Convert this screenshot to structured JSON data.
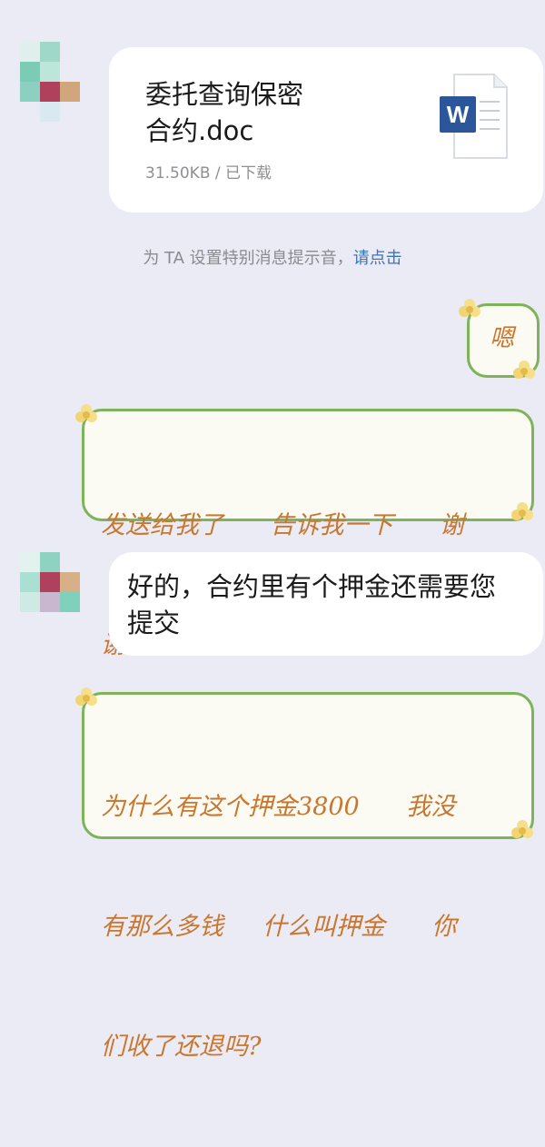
{
  "file": {
    "name_line1": "委托查询保密",
    "name_line2": "合约.doc",
    "meta": "31.50KB / 已下载",
    "icon": "word-doc-icon",
    "icon_letter": "W"
  },
  "notice": {
    "text": "为 TA 设置特别消息提示音，",
    "link": "请点击"
  },
  "messages": {
    "m1": "嗯",
    "m2_line1": "发送给我了      告诉我一下      谢",
    "m2_line2": "谢   辛苦了",
    "m3_line1": "好的，合约里有个押金还需要您",
    "m3_line2": "提交",
    "m4_line1": "为什么有这个押金3800      我没",
    "m4_line2": "有那么多钱     什么叫押金      你",
    "m4_line3": "们收了还退吗?"
  },
  "colors": {
    "background": "#ebebf5",
    "word_blue": "#2b579a",
    "bubble_border": "#7fb35a",
    "bubble_text": "#c9762e",
    "link": "#3d73b8"
  }
}
